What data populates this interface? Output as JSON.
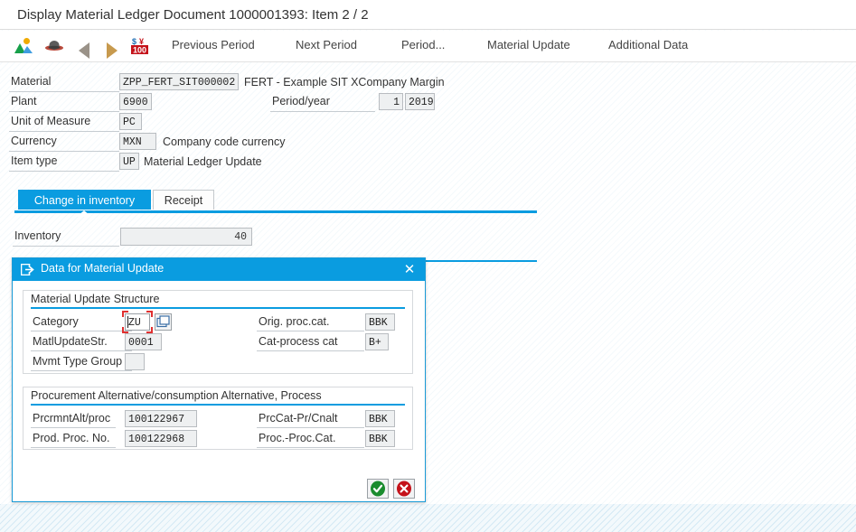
{
  "window": {
    "title": "Display Material Ledger Document 1000001393: Item 2 / 2"
  },
  "toolbar": {
    "icons": [
      {
        "name": "picture-icon",
        "label": "Display picture"
      },
      {
        "name": "hat-icon",
        "label": "Display role"
      },
      {
        "name": "previous-arrow-icon",
        "label": "Previous"
      },
      {
        "name": "next-arrow-icon",
        "label": "Next"
      },
      {
        "name": "price-100-icon",
        "label": "Prices"
      }
    ],
    "buttons": [
      {
        "name": "previous-period",
        "label": "Previous Period"
      },
      {
        "name": "next-period",
        "label": "Next Period"
      },
      {
        "name": "period-more",
        "label": "Period..."
      },
      {
        "name": "material-update",
        "label": "Material Update"
      },
      {
        "name": "additional-data",
        "label": "Additional Data"
      }
    ]
  },
  "header": {
    "material_label": "Material",
    "material_value": "ZPP_FERT_SIT000002",
    "material_desc": "FERT - Example SIT XCompany Margin",
    "plant_label": "Plant",
    "plant_value": "6900",
    "period_year_label": "Period/year",
    "period_value": "1",
    "year_value": "2019",
    "uom_label": "Unit of Measure",
    "uom_value": "PC",
    "currency_label": "Currency",
    "currency_value": "MXN",
    "currency_desc": "Company code currency",
    "item_type_label": "Item type",
    "item_type_value": "UP",
    "item_type_desc": "Material Ledger Update"
  },
  "tabs": [
    {
      "label": "Change in inventory",
      "active": true
    },
    {
      "label": "Receipt",
      "active": false
    }
  ],
  "inventory": {
    "label": "Inventory",
    "value": "40"
  },
  "dialog": {
    "title": "Data for Material Update",
    "close_label": "✕",
    "group1": {
      "title": "Material Update Structure",
      "fields": [
        {
          "label": "Category",
          "value": "ZU"
        },
        {
          "label": "MatlUpdateStr.",
          "value": "0001"
        },
        {
          "label": "Mvmt Type Group",
          "value": ""
        }
      ],
      "right_fields": [
        {
          "label": "Orig. proc.cat.",
          "value": "BBK"
        },
        {
          "label": "Cat-process cat",
          "value": "B+"
        }
      ]
    },
    "group2": {
      "title": "Procurement Alternative/consumption Alternative, Process",
      "fields": [
        {
          "label": "PrcrmntAlt/proc",
          "value": "100122967"
        },
        {
          "label": "Prod. Proc. No.",
          "value": "100122968"
        }
      ],
      "right_fields": [
        {
          "label": "PrcCat-Pr/Cnalt",
          "value": "BBK"
        },
        {
          "label": "Proc.-Proc.Cat.",
          "value": "BBK"
        }
      ]
    },
    "confirm_label": "Continue",
    "cancel_label": "Cancel"
  },
  "colors": {
    "accent": "#0a9ce0",
    "field_bg": "#eef0f1",
    "focus_red": "#e03030",
    "ok_green": "#1a8c2e",
    "cancel_red": "#c4121a"
  }
}
